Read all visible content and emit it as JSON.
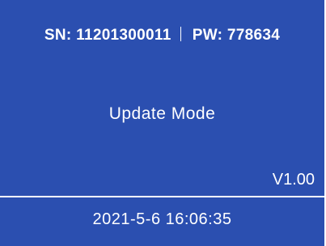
{
  "header": {
    "sn_label": "SN:",
    "sn_value": "11201300011",
    "pw_label": "PW:",
    "pw_value": "778634"
  },
  "main": {
    "mode_text": "Update Mode",
    "version": "V1.00"
  },
  "footer": {
    "datetime": "2021-5-6 16:06:35"
  },
  "colors": {
    "background": "#2b4fb0",
    "text": "#ffffff",
    "divider": "#ffffff"
  }
}
